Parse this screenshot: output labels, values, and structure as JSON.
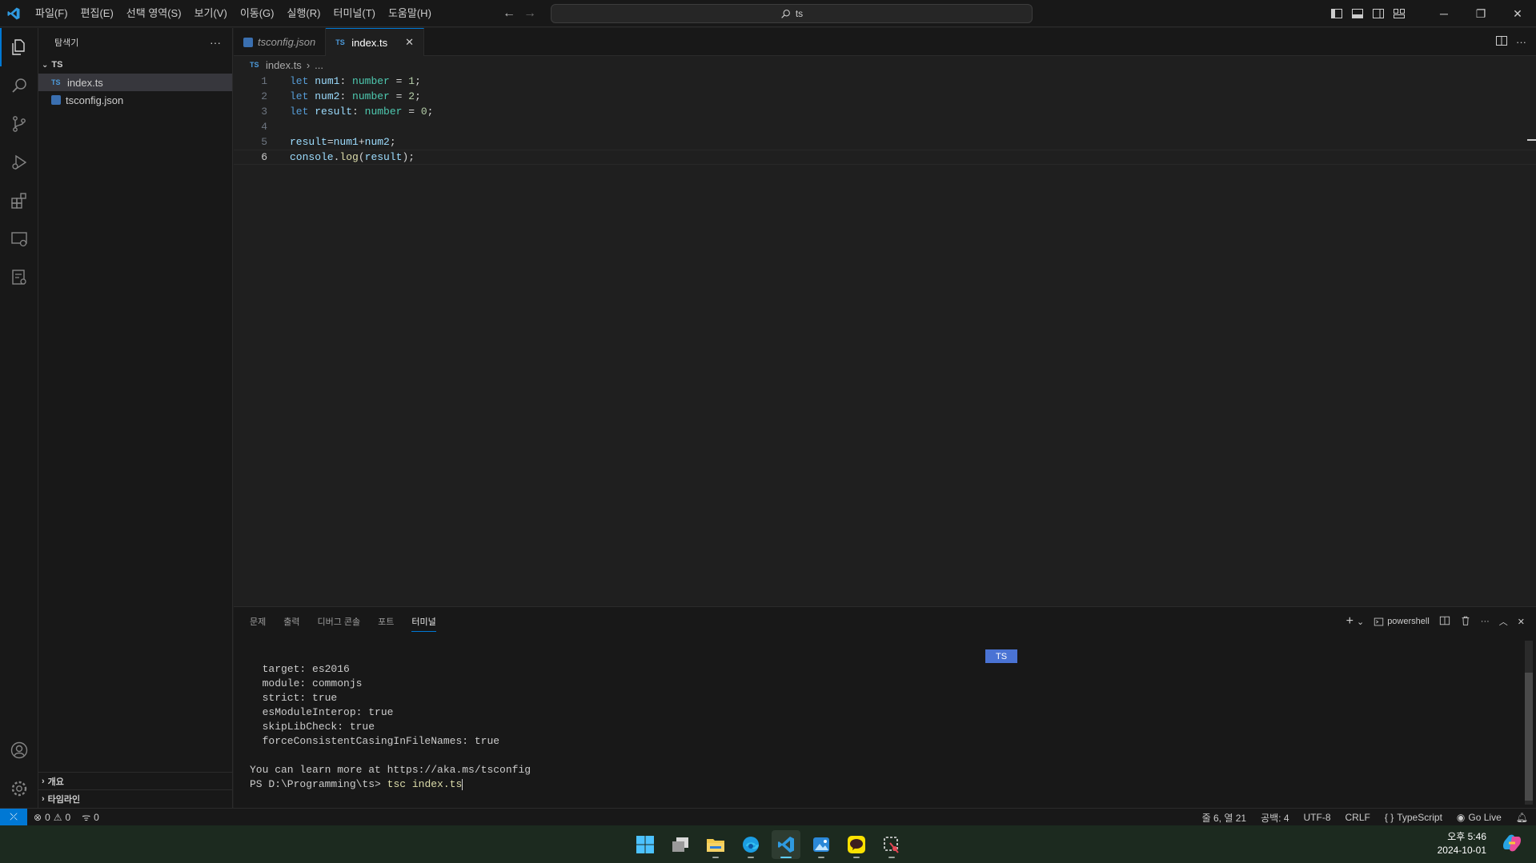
{
  "titlebar": {
    "menu": [
      "파일(F)",
      "편집(E)",
      "선택 영역(S)",
      "보기(V)",
      "이동(G)",
      "실행(R)",
      "터미널(T)",
      "도움말(H)"
    ],
    "search_text": "ts"
  },
  "sidebar": {
    "title": "탐색기",
    "folder": "TS",
    "files": [
      {
        "name": "index.ts",
        "type": "ts",
        "selected": true
      },
      {
        "name": "tsconfig.json",
        "type": "json",
        "selected": false
      }
    ],
    "outline_label": "개요",
    "timeline_label": "타임라인"
  },
  "tabs": [
    {
      "label": "tsconfig.json",
      "type": "json",
      "active": false
    },
    {
      "label": "index.ts",
      "type": "ts",
      "active": true
    }
  ],
  "breadcrumb": {
    "file": "index.ts",
    "more": "..."
  },
  "editor": {
    "lines": [
      {
        "n": "1",
        "tokens": [
          [
            "kw",
            "let"
          ],
          [
            "op",
            " "
          ],
          [
            "var",
            "num1"
          ],
          [
            "op",
            ": "
          ],
          [
            "typ",
            "number"
          ],
          [
            "op",
            " = "
          ],
          [
            "num",
            "1"
          ],
          [
            "op",
            ";"
          ]
        ]
      },
      {
        "n": "2",
        "tokens": [
          [
            "kw",
            "let"
          ],
          [
            "op",
            " "
          ],
          [
            "var",
            "num2"
          ],
          [
            "op",
            ": "
          ],
          [
            "typ",
            "number"
          ],
          [
            "op",
            " = "
          ],
          [
            "num",
            "2"
          ],
          [
            "op",
            ";"
          ]
        ]
      },
      {
        "n": "3",
        "tokens": [
          [
            "kw",
            "let"
          ],
          [
            "op",
            " "
          ],
          [
            "var",
            "result"
          ],
          [
            "op",
            ": "
          ],
          [
            "typ",
            "number"
          ],
          [
            "op",
            " = "
          ],
          [
            "num",
            "0"
          ],
          [
            "op",
            ";"
          ]
        ]
      },
      {
        "n": "4",
        "tokens": []
      },
      {
        "n": "5",
        "tokens": [
          [
            "var",
            "result"
          ],
          [
            "op",
            "="
          ],
          [
            "var",
            "num1"
          ],
          [
            "op",
            "+"
          ],
          [
            "var",
            "num2"
          ],
          [
            "op",
            ";"
          ]
        ]
      },
      {
        "n": "6",
        "tokens": [
          [
            "var",
            "console"
          ],
          [
            "op",
            "."
          ],
          [
            "fn",
            "log"
          ],
          [
            "op",
            "("
          ],
          [
            "var",
            "result"
          ],
          [
            "op",
            ");"
          ]
        ],
        "current": true
      }
    ]
  },
  "panel": {
    "tabs": [
      "문제",
      "출력",
      "디버그 콘솔",
      "포트",
      "터미널"
    ],
    "active_tab": "터미널",
    "shell_label": "powershell",
    "badge": "TS",
    "terminal_lines": [
      "  target: es2016",
      "  module: commonjs",
      "  strict: true",
      "  esModuleInterop: true",
      "  skipLibCheck: true",
      "  forceConsistentCasingInFileNames: true",
      "",
      "You can learn more at https://aka.ms/tsconfig"
    ],
    "prompt": "PS D:\\Programming\\ts> ",
    "command": "tsc index.ts"
  },
  "statusbar": {
    "errors": "0",
    "warnings": "0",
    "ports": "0",
    "position": "줄 6, 열 21",
    "spaces": "공백: 4",
    "encoding": "UTF-8",
    "eol": "CRLF",
    "language": "TypeScript",
    "golive": "Go Live"
  },
  "taskbar": {
    "time": "오후 5:46",
    "date": "2024-10-01",
    "apps": [
      "windows-start",
      "task-view",
      "file-explorer",
      "edge",
      "vscode",
      "photos",
      "kakaotalk",
      "snipping-tool"
    ]
  },
  "colors": {
    "accent": "#0078d4",
    "ts_chip": "#4a73d4",
    "keyword": "#569cd6",
    "variable": "#9cdcfe",
    "type": "#4ec9b0",
    "number": "#b5cea8"
  }
}
